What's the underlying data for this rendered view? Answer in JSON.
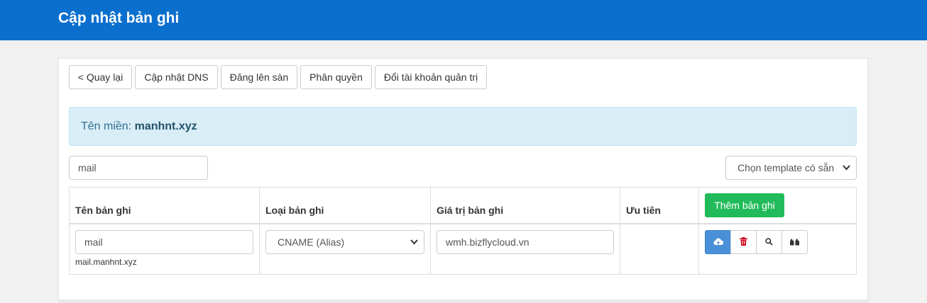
{
  "header": {
    "title": "Cập nhật bản ghi"
  },
  "toolbar": {
    "back": "< Quay lại",
    "update_dns": "Cập nhật DNS",
    "list_market": "Đăng lên sàn",
    "permissions": "Phân quyền",
    "change_admin": "Đổi tài khoản quản trị"
  },
  "domain_alert": {
    "label": "Tên miền: ",
    "value": "manhnt.xyz"
  },
  "filter": {
    "search_value": "mail",
    "template_select": "Chọn template có sẵn"
  },
  "table": {
    "headers": [
      "Tên bản ghi",
      "Loại bản ghi",
      "Giá trị bản ghi",
      "Ưu tiên"
    ],
    "add_button": "Thêm bản ghi",
    "rows": [
      {
        "name": "mail",
        "fqdn": "mail.manhnt.xyz",
        "type": "CNAME (Alias)",
        "value": "wmh.bizflycloud.vn",
        "priority": ""
      }
    ]
  },
  "icons": {
    "save": "cloud-upload-icon",
    "delete": "trash-icon",
    "search": "search-icon",
    "quote": "quote-icon"
  },
  "colors": {
    "topbar": "#0b6fcd",
    "add_button": "#22bb5b",
    "save_button": "#4a90d9",
    "delete_icon": "#d0021b",
    "alert_bg": "#d9edf7"
  }
}
